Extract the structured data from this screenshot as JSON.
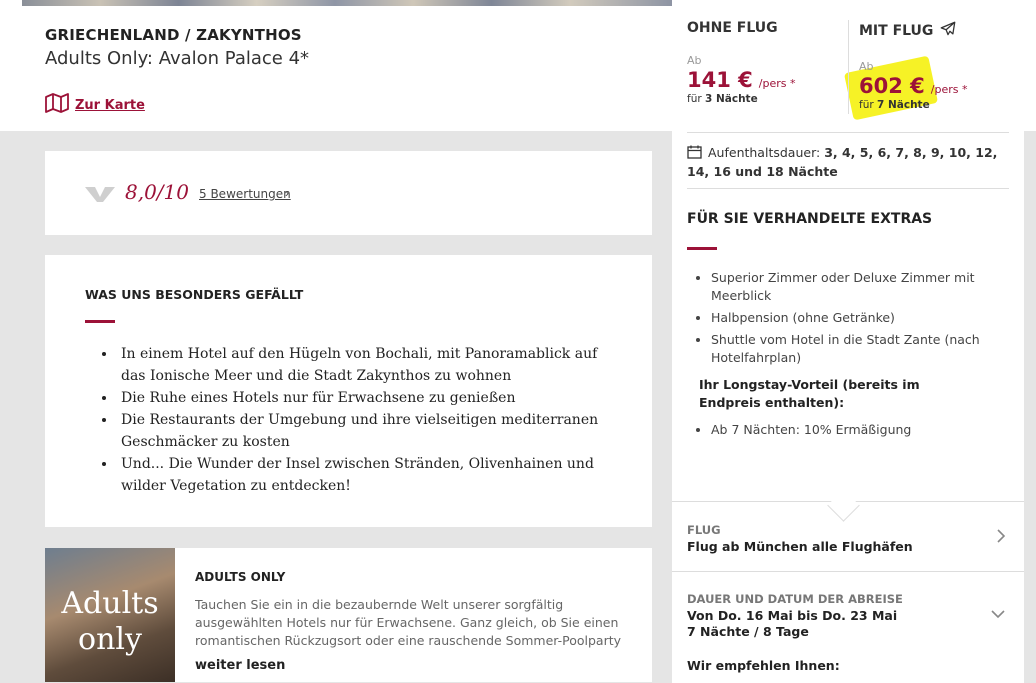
{
  "header": {
    "region": "GRIECHENLAND / ZAKYNTHOS",
    "hotel_name": "Adults Only: Avalon Palace 4*",
    "map_link": "Zur Karte"
  },
  "rating": {
    "score": "8,0/10",
    "reviews_link": "5 Bewertungen"
  },
  "highlights": {
    "title": "WAS UNS BESONDERS GEFÄLLT",
    "items": [
      "In einem Hotel auf den Hügeln von Bochali, mit Panoramablick auf das Ionische Meer und die Stadt Zakynthos zu wohnen",
      "Die Ruhe eines Hotels nur für Erwachsene zu genießen",
      "Die Restaurants der Umgebung und ihre vielseitigen mediterranen Geschmäcker zu kosten",
      "Und... Die Wunder der Insel zwischen Stränden, Olivenhainen und wilder Vegetation zu entdecken!"
    ]
  },
  "adults_only": {
    "image_text_line1": "Adults",
    "image_text_line2": "only",
    "title": "ADULTS ONLY",
    "text": "Tauchen Sie ein in die bezaubernde Welt unserer sorgfältig ausgewählten Hotels nur für Erwachsene. Ganz gleich, ob Sie einen romantischen Rückzugsort oder eine rauschende Sommer-Poolparty suchen, unsere",
    "read_more": "weiter lesen"
  },
  "pricing": {
    "without_flight": {
      "label": "OHNE FLUG",
      "from": "Ab",
      "amount": "141 €",
      "unit": "/pers *",
      "nights_prefix": "für",
      "nights": "3 Nächte"
    },
    "with_flight": {
      "label": "MIT FLUG",
      "from": "Ab",
      "amount": "602 €",
      "unit": "/pers *",
      "nights_prefix": "für",
      "nights": "7 Nächte"
    }
  },
  "stay": {
    "label": "Aufenthaltsdauer:",
    "values": "3, 4, 5, 6, 7, 8, 9, 10, 12, 14, 16 und 18 Nächte"
  },
  "extras": {
    "title": "FÜR SIE VERHANDELTE EXTRAS",
    "items": [
      "Superior Zimmer oder Deluxe Zimmer mit Meerblick",
      "Halbpension (ohne Getränke)",
      "Shuttle vom Hotel in die Stadt Zante (nach Hotelfahrplan)"
    ],
    "longstay_title": "Ihr Longstay-Vorteil (bereits im Endpreis enthalten):",
    "longstay_items": [
      "Ab 7 Nächten: 10% Ermäßigung"
    ]
  },
  "flight": {
    "label": "FLUG",
    "value": "Flug ab München alle Flughäfen"
  },
  "departure": {
    "label": "DAUER UND DATUM DER ABREISE",
    "dates": "Von Do. 16 Mai bis Do. 23 Mai",
    "duration": "7 Nächte / 8 Tage"
  },
  "recommend": "Wir empfehlen Ihnen:",
  "colors": {
    "accent": "#9c1238",
    "highlight": "#f5f000",
    "background": "#e5e5e5"
  },
  "icons": [
    "map-icon",
    "rating-logo-icon",
    "chevron-right-icon",
    "plane-icon",
    "calendar-icon",
    "chevron-down-icon"
  ]
}
